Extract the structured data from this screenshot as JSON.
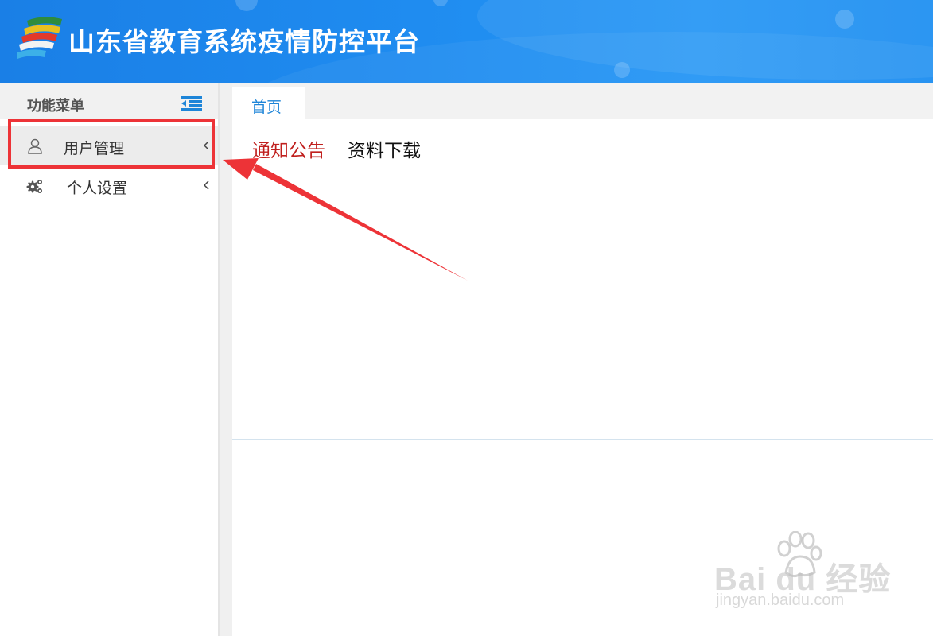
{
  "header": {
    "site_title": "山东省教育系统疫情防控平台",
    "logo_icon": "province-logo-icon",
    "background_color": "#1f8cf0"
  },
  "sidebar": {
    "menu_title": "功能菜单",
    "collapse_icon": "menu-collapse-icon",
    "accent_color": "#1e85d8",
    "items": [
      {
        "label": "用户管理",
        "icon": "user-icon",
        "chevron": "chevron-left-icon",
        "highlighted": true
      },
      {
        "label": "个人设置",
        "icon": "gears-icon",
        "chevron": "chevron-left-icon",
        "highlighted": false
      }
    ]
  },
  "tabs": [
    {
      "label": "首页",
      "active": true
    }
  ],
  "content": {
    "sub_tabs": [
      {
        "label": "通知公告",
        "active": true,
        "color": "#c0201e"
      },
      {
        "label": "资料下载",
        "active": false,
        "color": "#111111"
      }
    ]
  },
  "annotation": {
    "box_color": "#ed3337",
    "arrow_color": "#ed3337"
  },
  "watermark": {
    "brand": "Bai du 经验",
    "url": "jingyan.baidu.com"
  }
}
